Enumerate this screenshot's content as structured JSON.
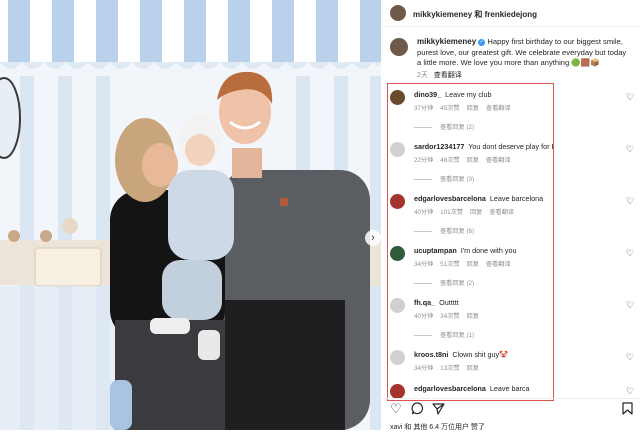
{
  "post": {
    "header_title": "mikkykiemeney 和 frenkiedejong",
    "author": "mikkykiemeney",
    "caption": "Happy first birthday to our biggest smile, purest love, our greatest gift. We celebrate everyday but today a little more. We love you more than anything",
    "caption_emoji": "🟢🟫📦",
    "age": "2天",
    "see_translation": "查看翻译"
  },
  "comments": [
    {
      "user": "dino39_",
      "text": "Leave my club",
      "time": "37分钟",
      "likes": "45次赞",
      "reply": "回复",
      "translate": "查看翻译",
      "replies": "查看回复 (2)",
      "avatar_color": "#6b4a2a"
    },
    {
      "user": "sardor1234177",
      "text": "You dont deserve play for Barsa",
      "time": "22分钟",
      "likes": "46次赞",
      "reply": "回复",
      "translate": "查看翻译",
      "replies": "查看回复 (3)",
      "avatar_color": "#d0d0d0"
    },
    {
      "user": "edgarlovesbarcelona",
      "text": "Leave barcelona",
      "time": "40分钟",
      "likes": "101次赞",
      "reply": "回复",
      "translate": "查看翻译",
      "replies": "查看回复 (6)",
      "avatar_color": "#a4342c"
    },
    {
      "user": "ucuptampan",
      "text": "I'm done with you",
      "time": "34分钟",
      "likes": "51次赞",
      "reply": "回复",
      "translate": "查看翻译",
      "replies": "查看回复 (2)",
      "avatar_color": "#2f5a3c"
    },
    {
      "user": "fh.qa_",
      "text": "Outtttt",
      "time": "40分钟",
      "likes": "34次赞",
      "reply": "回复",
      "translate": "",
      "replies": "查看回复 (1)",
      "avatar_color": "#d0d0d0"
    },
    {
      "user": "kroos.t8ni",
      "text": "Clown shit guy🤡",
      "time": "34分钟",
      "likes": "13次赞",
      "reply": "回复",
      "translate": "",
      "replies": "",
      "avatar_color": "#d0d0d0"
    },
    {
      "user": "edgarlovesbarcelona",
      "text": "Leave barca",
      "time": "",
      "likes": "",
      "reply": "",
      "translate": "",
      "replies": "",
      "avatar_color": "#a4342c"
    }
  ],
  "footer": {
    "liked_by": "xavi 和 其他 6.4 万位用户 赞了"
  },
  "icons": {
    "like": "heart-icon",
    "comment": "comment-icon",
    "share": "share-icon",
    "save": "bookmark-icon",
    "verified": "verified-badge-icon"
  },
  "colors": {
    "highlight_box": "#d9534f",
    "verified": "#3897f0",
    "muted_text": "#8e8e8e"
  }
}
